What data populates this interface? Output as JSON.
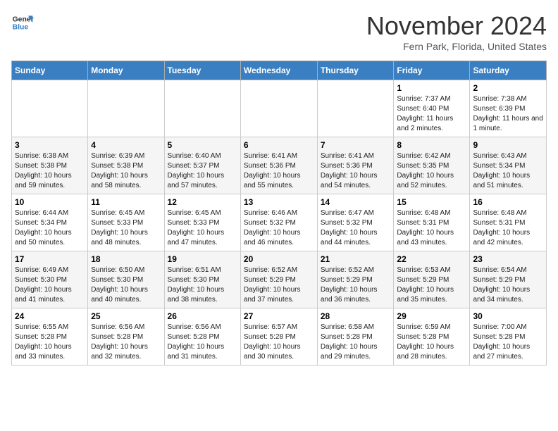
{
  "header": {
    "logo_line1": "General",
    "logo_line2": "Blue",
    "month_title": "November 2024",
    "location": "Fern Park, Florida, United States"
  },
  "weekdays": [
    "Sunday",
    "Monday",
    "Tuesday",
    "Wednesday",
    "Thursday",
    "Friday",
    "Saturday"
  ],
  "weeks": [
    [
      {
        "day": "",
        "info": ""
      },
      {
        "day": "",
        "info": ""
      },
      {
        "day": "",
        "info": ""
      },
      {
        "day": "",
        "info": ""
      },
      {
        "day": "",
        "info": ""
      },
      {
        "day": "1",
        "info": "Sunrise: 7:37 AM\nSunset: 6:40 PM\nDaylight: 11 hours and 2 minutes."
      },
      {
        "day": "2",
        "info": "Sunrise: 7:38 AM\nSunset: 6:39 PM\nDaylight: 11 hours and 1 minute."
      }
    ],
    [
      {
        "day": "3",
        "info": "Sunrise: 6:38 AM\nSunset: 5:38 PM\nDaylight: 10 hours and 59 minutes."
      },
      {
        "day": "4",
        "info": "Sunrise: 6:39 AM\nSunset: 5:38 PM\nDaylight: 10 hours and 58 minutes."
      },
      {
        "day": "5",
        "info": "Sunrise: 6:40 AM\nSunset: 5:37 PM\nDaylight: 10 hours and 57 minutes."
      },
      {
        "day": "6",
        "info": "Sunrise: 6:41 AM\nSunset: 5:36 PM\nDaylight: 10 hours and 55 minutes."
      },
      {
        "day": "7",
        "info": "Sunrise: 6:41 AM\nSunset: 5:36 PM\nDaylight: 10 hours and 54 minutes."
      },
      {
        "day": "8",
        "info": "Sunrise: 6:42 AM\nSunset: 5:35 PM\nDaylight: 10 hours and 52 minutes."
      },
      {
        "day": "9",
        "info": "Sunrise: 6:43 AM\nSunset: 5:34 PM\nDaylight: 10 hours and 51 minutes."
      }
    ],
    [
      {
        "day": "10",
        "info": "Sunrise: 6:44 AM\nSunset: 5:34 PM\nDaylight: 10 hours and 50 minutes."
      },
      {
        "day": "11",
        "info": "Sunrise: 6:45 AM\nSunset: 5:33 PM\nDaylight: 10 hours and 48 minutes."
      },
      {
        "day": "12",
        "info": "Sunrise: 6:45 AM\nSunset: 5:33 PM\nDaylight: 10 hours and 47 minutes."
      },
      {
        "day": "13",
        "info": "Sunrise: 6:46 AM\nSunset: 5:32 PM\nDaylight: 10 hours and 46 minutes."
      },
      {
        "day": "14",
        "info": "Sunrise: 6:47 AM\nSunset: 5:32 PM\nDaylight: 10 hours and 44 minutes."
      },
      {
        "day": "15",
        "info": "Sunrise: 6:48 AM\nSunset: 5:31 PM\nDaylight: 10 hours and 43 minutes."
      },
      {
        "day": "16",
        "info": "Sunrise: 6:48 AM\nSunset: 5:31 PM\nDaylight: 10 hours and 42 minutes."
      }
    ],
    [
      {
        "day": "17",
        "info": "Sunrise: 6:49 AM\nSunset: 5:30 PM\nDaylight: 10 hours and 41 minutes."
      },
      {
        "day": "18",
        "info": "Sunrise: 6:50 AM\nSunset: 5:30 PM\nDaylight: 10 hours and 40 minutes."
      },
      {
        "day": "19",
        "info": "Sunrise: 6:51 AM\nSunset: 5:30 PM\nDaylight: 10 hours and 38 minutes."
      },
      {
        "day": "20",
        "info": "Sunrise: 6:52 AM\nSunset: 5:29 PM\nDaylight: 10 hours and 37 minutes."
      },
      {
        "day": "21",
        "info": "Sunrise: 6:52 AM\nSunset: 5:29 PM\nDaylight: 10 hours and 36 minutes."
      },
      {
        "day": "22",
        "info": "Sunrise: 6:53 AM\nSunset: 5:29 PM\nDaylight: 10 hours and 35 minutes."
      },
      {
        "day": "23",
        "info": "Sunrise: 6:54 AM\nSunset: 5:29 PM\nDaylight: 10 hours and 34 minutes."
      }
    ],
    [
      {
        "day": "24",
        "info": "Sunrise: 6:55 AM\nSunset: 5:28 PM\nDaylight: 10 hours and 33 minutes."
      },
      {
        "day": "25",
        "info": "Sunrise: 6:56 AM\nSunset: 5:28 PM\nDaylight: 10 hours and 32 minutes."
      },
      {
        "day": "26",
        "info": "Sunrise: 6:56 AM\nSunset: 5:28 PM\nDaylight: 10 hours and 31 minutes."
      },
      {
        "day": "27",
        "info": "Sunrise: 6:57 AM\nSunset: 5:28 PM\nDaylight: 10 hours and 30 minutes."
      },
      {
        "day": "28",
        "info": "Sunrise: 6:58 AM\nSunset: 5:28 PM\nDaylight: 10 hours and 29 minutes."
      },
      {
        "day": "29",
        "info": "Sunrise: 6:59 AM\nSunset: 5:28 PM\nDaylight: 10 hours and 28 minutes."
      },
      {
        "day": "30",
        "info": "Sunrise: 7:00 AM\nSunset: 5:28 PM\nDaylight: 10 hours and 27 minutes."
      }
    ]
  ]
}
